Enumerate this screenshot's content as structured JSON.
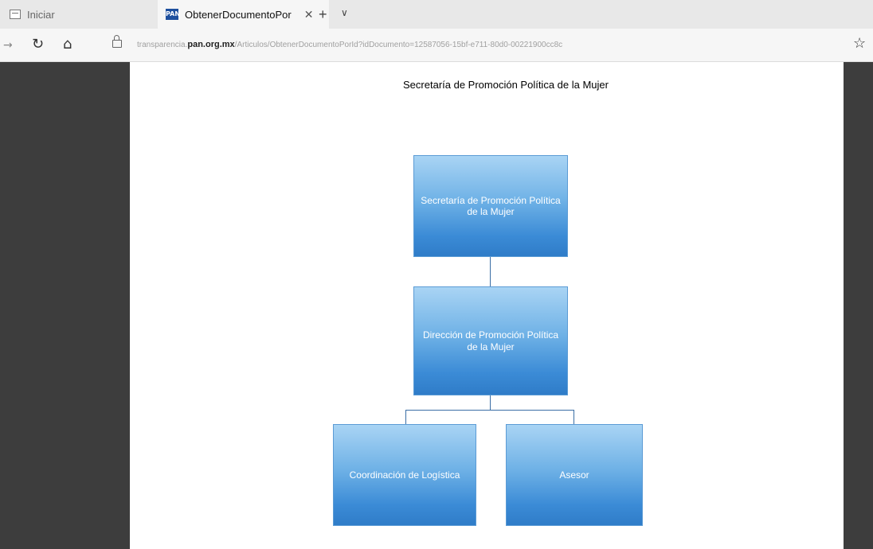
{
  "browser": {
    "tabs": [
      {
        "label": "Iniciar",
        "icon": "page-icon"
      },
      {
        "label": "ObtenerDocumentoPor",
        "icon": "pan-logo-icon",
        "logo_text": "PAN"
      }
    ],
    "close_symbol": "✕",
    "new_tab_symbol": "+",
    "tab_menu_symbol": "∨",
    "nav": {
      "back_symbol": "→",
      "refresh_symbol": "↻",
      "home_symbol": "⌂",
      "star_symbol": "☆"
    },
    "address": {
      "prefix": "transparencia.",
      "host": "pan.org.mx",
      "path": "/Articulos/ObtenerDocumentoPorId?idDocumento=12587056-15bf-e711-80d0-00221900cc8c"
    }
  },
  "org_chart": {
    "title": "Secretaría de Promoción Política de la Mujer",
    "boxes": [
      {
        "label": "Secretaría de Promoción Política de la Mujer"
      },
      {
        "label": "Dirección de Promoción Política de la Mujer"
      },
      {
        "label": "Coordinación de Logística"
      },
      {
        "label": "Asesor"
      }
    ]
  },
  "colors": {
    "box_top": "#a9d4f4",
    "box_bottom": "#2f7cc8",
    "viewer_background": "#3d3d3d"
  }
}
